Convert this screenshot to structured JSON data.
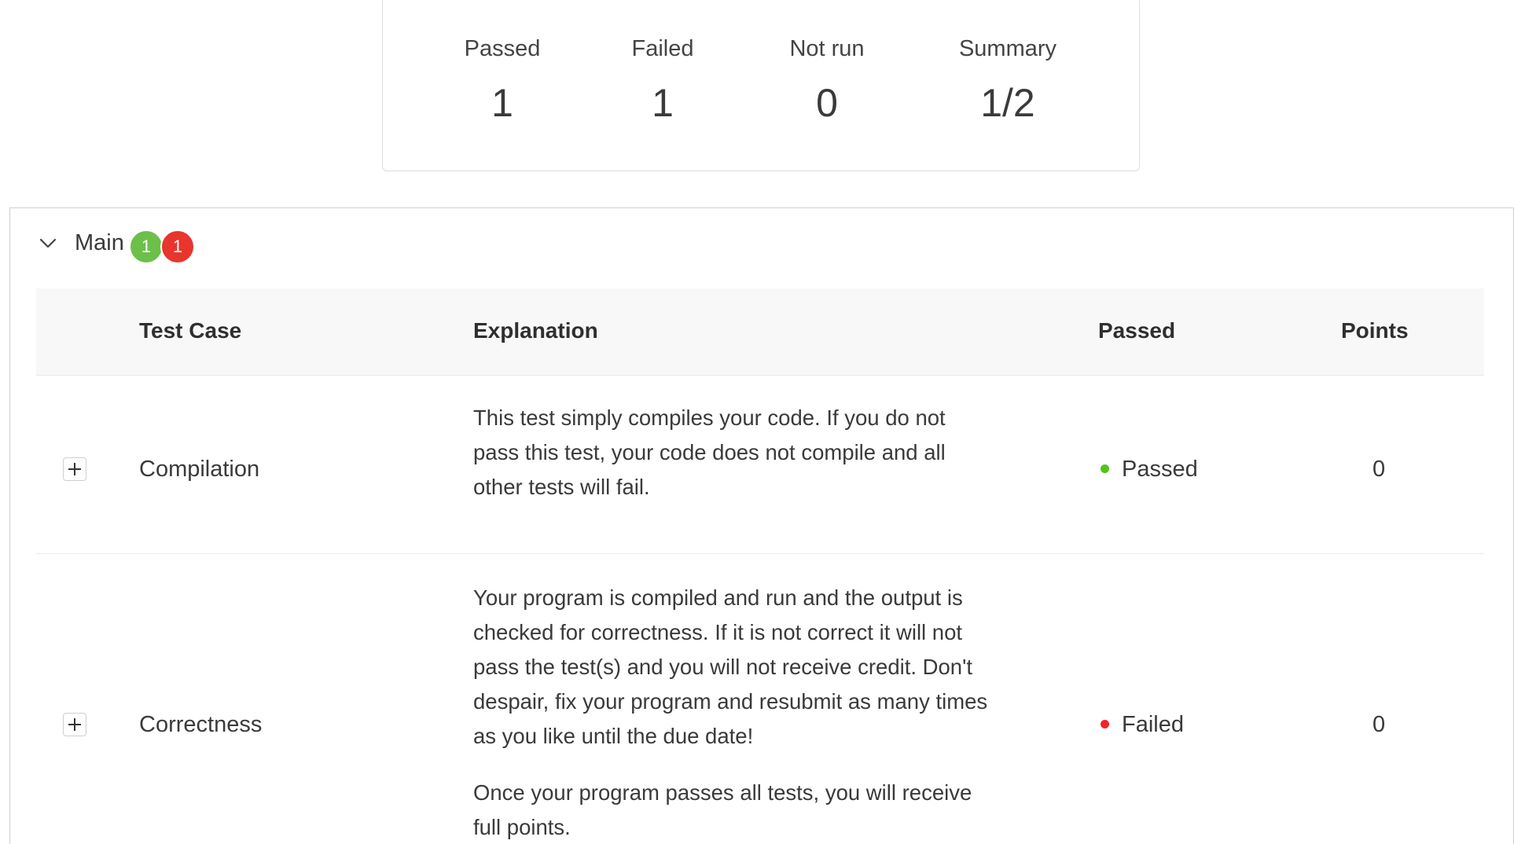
{
  "summary": {
    "passed_label": "Passed",
    "passed_value": "1",
    "failed_label": "Failed",
    "failed_value": "1",
    "not_run_label": "Not run",
    "not_run_value": "0",
    "summary_label": "Summary",
    "summary_value": "1/2"
  },
  "group": {
    "title": "Main",
    "passed_count": "1",
    "failed_count": "1",
    "colors": {
      "passed_badge": "#6cc04a",
      "failed_badge": "#e8352d"
    }
  },
  "table": {
    "headers": {
      "test_case": "Test Case",
      "explanation": "Explanation",
      "passed": "Passed",
      "points": "Points"
    },
    "rows": [
      {
        "test_case": "Compilation",
        "explanation": [
          "This test simply compiles your code. If you do not pass this test, your code does not compile and all other tests will fail."
        ],
        "status": "Passed",
        "status_color": "#52c41a",
        "points": "0"
      },
      {
        "test_case": "Correctness",
        "explanation": [
          "Your program is compiled and run and the output is checked for correctness. If it is not correct it will not pass the test(s) and you will not receive credit. Don't despair, fix your program and resubmit as many times as you like until the due date!",
          "Once your program passes all tests, you will receive full points."
        ],
        "status": "Failed",
        "status_color": "#f5222d",
        "points": "0"
      }
    ]
  },
  "icons": {
    "collapse": "chevron-down-icon",
    "expand": "plus-icon",
    "status": "status-dot-icon"
  }
}
